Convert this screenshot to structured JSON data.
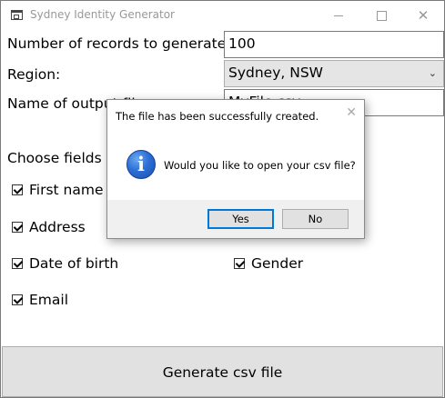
{
  "window": {
    "title": "Sydney Identity Generator",
    "buttons": {
      "minimize": "minimize",
      "maximize": "maximize",
      "close": "✕"
    }
  },
  "form": {
    "records_label": "Number of records to generate:",
    "records_value": "100",
    "region_label": "Region:",
    "region_value": "Sydney, NSW",
    "region_chevron": "⌄",
    "output_label": "Name of output file:",
    "output_value": "MyFile.csv",
    "fields_label": "Choose fields to include:"
  },
  "checkboxes": [
    {
      "label": "First name",
      "checked": true
    },
    {
      "label": "Address",
      "checked": true
    },
    {
      "label": "Date of birth",
      "checked": true
    },
    {
      "label": "Gender",
      "checked": true
    },
    {
      "label": "Email",
      "checked": true
    }
  ],
  "generate_button": "Generate csv file",
  "dialog": {
    "title": "The file has been successfully created.",
    "close": "✕",
    "icon": "i",
    "message": "Would you like to open your csv file?",
    "yes": "Yes",
    "no": "No"
  },
  "colors": {
    "accent": "#0078d7",
    "button_bg": "#e1e1e1",
    "info_blue": "#2d6fd6"
  }
}
